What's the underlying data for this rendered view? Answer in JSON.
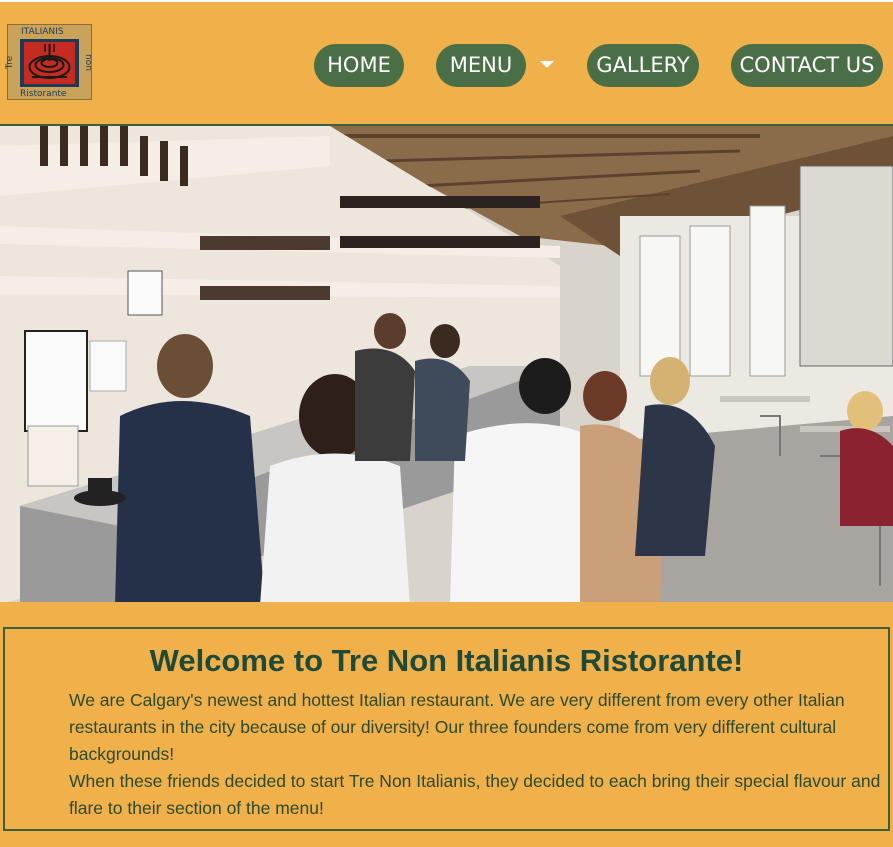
{
  "logo": {
    "top_text": "ITALIANIS",
    "bottom_text": "Ristorante",
    "left_text": "Tre",
    "right_text": "non",
    "icon": "pasta-fork-icon"
  },
  "nav": {
    "home": "HOME",
    "menu": "MENU",
    "gallery": "GALLERY",
    "contact": "CONTACT US"
  },
  "hero": {
    "description": "restaurant-interior-photo"
  },
  "welcome": {
    "title": "Welcome to Tre Non Italianis Ristorante!",
    "paragraph1": "We are Calgary's newest and hottest Italian restaurant. We are very different from every other Italian restaurants in the city because of our diversity! Our three founders come from very different cultural backgrounds!",
    "paragraph2": "When these friends decided to start Tre Non Italianis, they decided to each bring their special flavour and flare to their section of the menu!"
  },
  "colors": {
    "background": "#f0b04a",
    "nav_button": "#4a6e46",
    "title": "#1f4a3a",
    "border": "#3d5f3c"
  }
}
